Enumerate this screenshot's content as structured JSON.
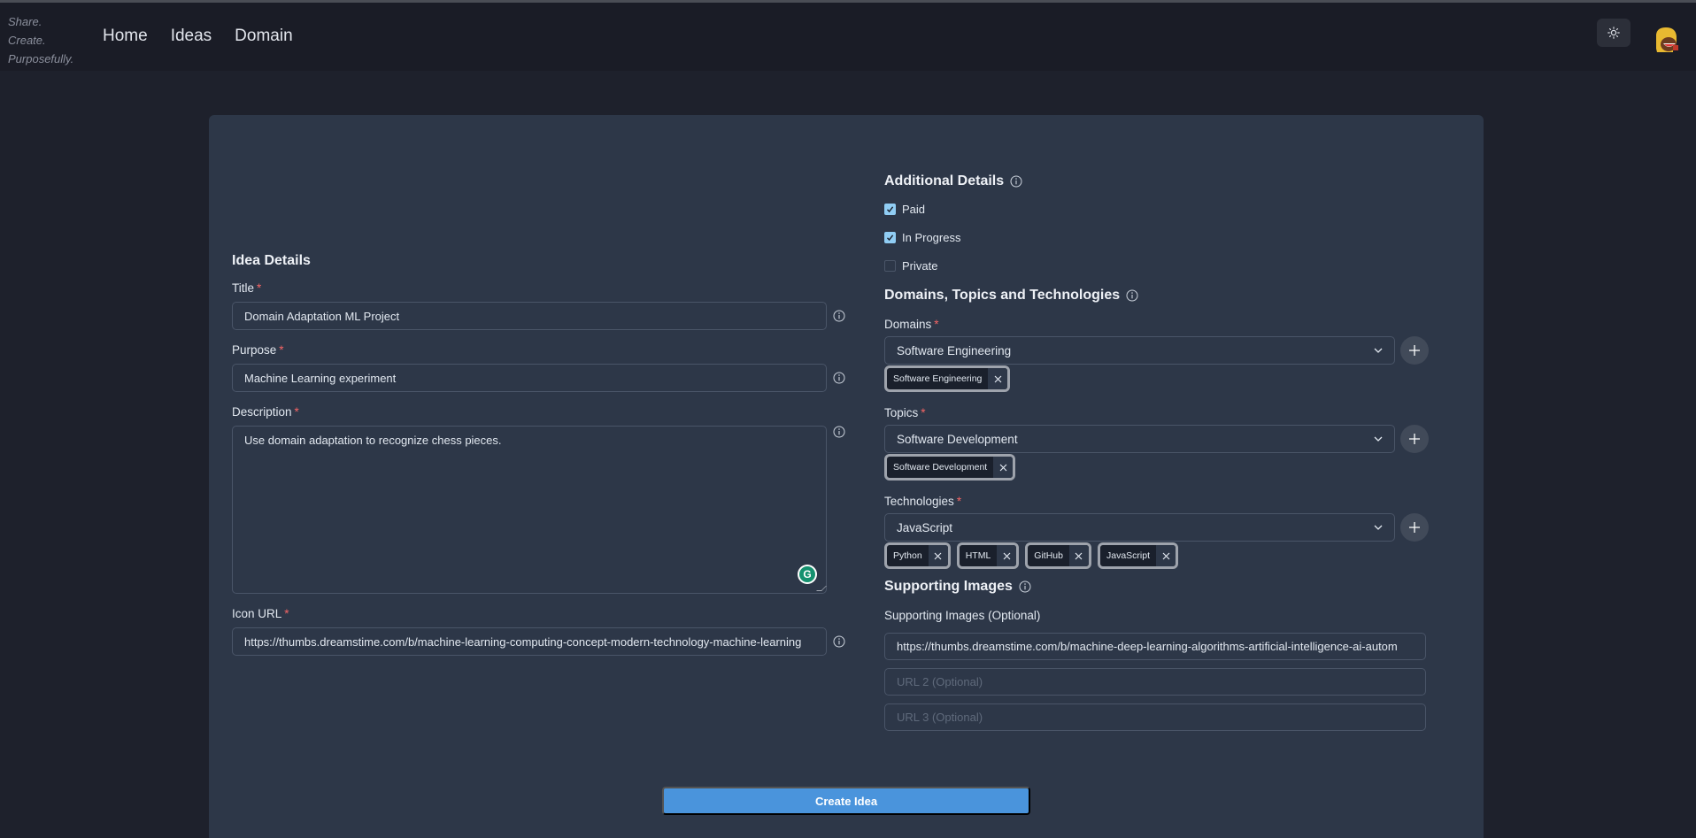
{
  "navbar": {
    "tagline": [
      "Share.",
      "Create.",
      "Purposefully."
    ],
    "links": [
      "Home",
      "Ideas",
      "Domain"
    ],
    "theme_icon": "sun-icon",
    "avatar_icon": "avatar-emoji"
  },
  "idea_details": {
    "heading": "Idea Details",
    "title": {
      "label": "Title",
      "value": "Domain Adaptation ML Project"
    },
    "purpose": {
      "label": "Purpose",
      "value": "Machine Learning experiment"
    },
    "description": {
      "label": "Description",
      "value": "Use domain adaptation to recognize chess pieces."
    },
    "icon_url": {
      "label": "Icon URL",
      "value": "https://thumbs.dreamstime.com/b/machine-learning-computing-concept-modern-technology-machine-learning"
    },
    "required_mark": "*"
  },
  "additional_details": {
    "heading": "Additional Details",
    "checkboxes": [
      {
        "label": "Paid",
        "checked": true
      },
      {
        "label": "In Progress",
        "checked": true
      },
      {
        "label": "Private",
        "checked": false
      }
    ]
  },
  "dtt": {
    "heading": "Domains, Topics and Technologies",
    "domains": {
      "label": "Domains",
      "selected": "Software Engineering",
      "tags": [
        "Software Engineering"
      ]
    },
    "topics": {
      "label": "Topics",
      "selected": "Software Development",
      "tags": [
        "Software Development"
      ]
    },
    "technologies": {
      "label": "Technologies",
      "selected": "JavaScript",
      "tags": [
        "Python",
        "HTML",
        "GitHub",
        "JavaScript"
      ]
    }
  },
  "supporting_images": {
    "heading": "Supporting Images",
    "label": "Supporting Images (Optional)",
    "url1": "https://thumbs.dreamstime.com/b/machine-deep-learning-algorithms-artificial-intelligence-ai-autom",
    "url2_placeholder": "URL 2 (Optional)",
    "url3_placeholder": "URL 3 (Optional)"
  },
  "actions": {
    "create_label": "Create Idea"
  },
  "colors": {
    "accent": "#4a94dc",
    "required": "#f56565",
    "checkbox": "#90cdf4",
    "card": "#2d3748",
    "page": "#1e212c",
    "navbar": "#1a1c26"
  }
}
